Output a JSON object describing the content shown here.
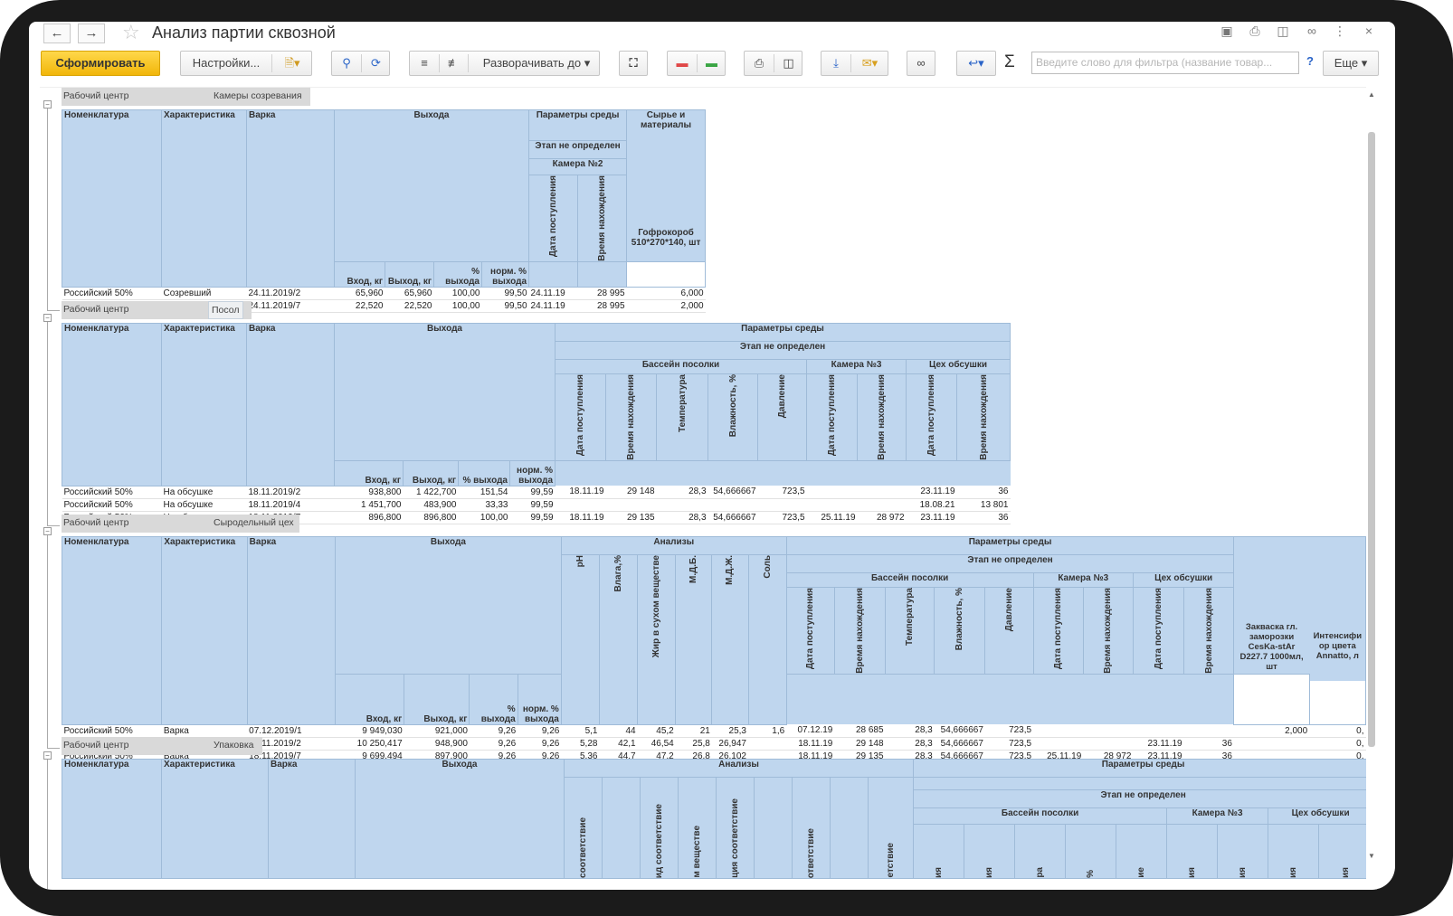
{
  "window": {
    "title": "Анализ партии сквозной"
  },
  "toolbar": {
    "generate": "Сформировать",
    "settings": "Настройки...",
    "expand": "Разворачивать до",
    "more": "Еще",
    "search_placeholder": "Введите слово для фильтра (название товар...",
    "help": "?"
  },
  "sections": [
    {
      "label": "Рабочий центр",
      "value": "Камеры созревания",
      "headers": {
        "nom": "Номенклатура",
        "char": "Характеристика",
        "var": "Варка",
        "vyhoda": "Выхода",
        "env": "Параметры среды",
        "raw": "Сырье и материалы",
        "stage": "Этап не определен",
        "cam": "Камера №2",
        "date": "Дата поступления",
        "time": "Время нахождения",
        "vin": "Вход, кг",
        "vout": "Выход, кг",
        "pct": "% выхода",
        "norm": "норм. % выхода",
        "gofro": "Гофрокороб 510*270*140, шт"
      },
      "rows": [
        [
          "Российский 50%",
          "Созревший",
          "24.11.2019/2",
          "65,960",
          "65,960",
          "100,00",
          "99,50",
          "24.11.19",
          "28 995",
          "6,000"
        ],
        [
          "Российский 50%",
          "Созревший",
          "24.11.2019/7",
          "22,520",
          "22,520",
          "100,00",
          "99,50",
          "24.11.19",
          "28 995",
          "2,000"
        ]
      ]
    },
    {
      "label": "Рабочий центр",
      "value": "Посол",
      "headers": {
        "nom": "Номенклатура",
        "char": "Характеристика",
        "var": "Варка",
        "vyhoda": "Выхода",
        "env": "Параметры среды",
        "stage": "Этап не определен",
        "pool": "Бассейн посолки",
        "cam3": "Камера №3",
        "dry": "Цех обсушки",
        "date": "Дата поступления",
        "time": "Время нахождения",
        "temp": "Температура",
        "hum": "Влажность, %",
        "press": "Давление",
        "vin": "Вход, кг",
        "vout": "Выход, кг",
        "pct": "% выхода",
        "norm": "норм. % выхода"
      },
      "rows": [
        [
          "Российский 50%",
          "На обсушке",
          "18.11.2019/2",
          "938,800",
          "1 422,700",
          "151,54",
          "99,59",
          "18.11.19",
          "29 148",
          "28,3",
          "54,666667",
          "723,5",
          "",
          "",
          "23.11.19",
          "36"
        ],
        [
          "Российский 50%",
          "На обсушке",
          "18.11.2019/4",
          "1 451,700",
          "483,900",
          "33,33",
          "99,59",
          "",
          "",
          "",
          "",
          "",
          "",
          "",
          "18.08.21",
          "13 801"
        ],
        [
          "Российский 50%",
          "На обсушке",
          "18.11.2019/7",
          "896,800",
          "896,800",
          "100,00",
          "99,59",
          "18.11.19",
          "29 135",
          "28,3",
          "54,666667",
          "723,5",
          "25.11.19",
          "28 972",
          "23.11.19",
          "36"
        ]
      ]
    },
    {
      "label": "Рабочий центр",
      "value": "Сыродельный цех",
      "headers": {
        "nom": "Номенклатура",
        "char": "Характеристика",
        "var": "Варка",
        "vyhoda": "Выхода",
        "anal": "Анализы",
        "ph": "pH",
        "vlaga": "Влага,%",
        "fat": "Жир в сухом веществе",
        "mdb": "М.Д.Б.",
        "mdzh": "М.Д.Ж.",
        "salt": "Соль",
        "env": "Параметры среды",
        "stage": "Этап не определен",
        "pool": "Бассейн посолки",
        "cam3": "Камера №3",
        "dry": "Цех обсушки",
        "date": "Дата поступления",
        "time": "Время нахождения",
        "temp": "Температура",
        "hum": "Влажность, %",
        "press": "Давление",
        "zakv": "Закваска гл. заморозки CesKa-stAr D227.7 1000мл, шт",
        "intens": "Интенсифи ор цвета Annatto, л",
        "vin": "Вход, кг",
        "vout": "Выход, кг",
        "pct": "% выхода",
        "norm": "норм. % выхода"
      },
      "rows": [
        [
          "Российский 50%",
          "Варка",
          "07.12.2019/1",
          "9 949,030",
          "921,000",
          "9,26",
          "9,26",
          "5,1",
          "44",
          "45,2",
          "21",
          "25,3",
          "1,6",
          "07.12.19",
          "28 685",
          "28,3",
          "54,666667",
          "723,5",
          "",
          "",
          "",
          "",
          "2,000",
          "0,"
        ],
        [
          "Российский 50%",
          "Варка",
          "18.11.2019/2",
          "10 250,417",
          "948,900",
          "9,26",
          "9,26",
          "5,28",
          "42,1",
          "46,54",
          "25,8",
          "26,947",
          "",
          "18.11.19",
          "29 148",
          "28,3",
          "54,666667",
          "723,5",
          "",
          "",
          "23.11.19",
          "36",
          "",
          "0,"
        ],
        [
          "Российский 50%",
          "Варка",
          "18.11.2019/7",
          "9 699,494",
          "897,900",
          "9,26",
          "9,26",
          "5,36",
          "44,7",
          "47,2",
          "26,8",
          "26,102",
          "",
          "18.11.19",
          "29 135",
          "28,3",
          "54,666667",
          "723,5",
          "25.11.19",
          "28 972",
          "23.11.19",
          "36",
          "",
          "0,"
        ]
      ]
    },
    {
      "label": "Рабочий центр",
      "value": "Упаковка",
      "headers": {
        "nom": "Номенклатура",
        "char": "Характеристика",
        "var": "Варка",
        "vyhoda": "Выхода",
        "anal": "Анализы",
        "env": "Параметры среды",
        "stage": "Этап не определен",
        "pool": "Бассейн посолки",
        "cam3": "Камера №3",
        "dry": "Цех обсушки",
        "a1": "соответствие",
        "a2": "ид соответствие",
        "a3": "м веществе",
        "a4": "ция соответствие",
        "a5": "ответствие",
        "a6": "етствие",
        "c1": "ия",
        "c2": "ия",
        "c3": "ра",
        "c4": "%",
        "c5": "ие",
        "c6": "ия",
        "c7": "ия",
        "c8": "ия",
        "c9": "ия"
      }
    }
  ]
}
